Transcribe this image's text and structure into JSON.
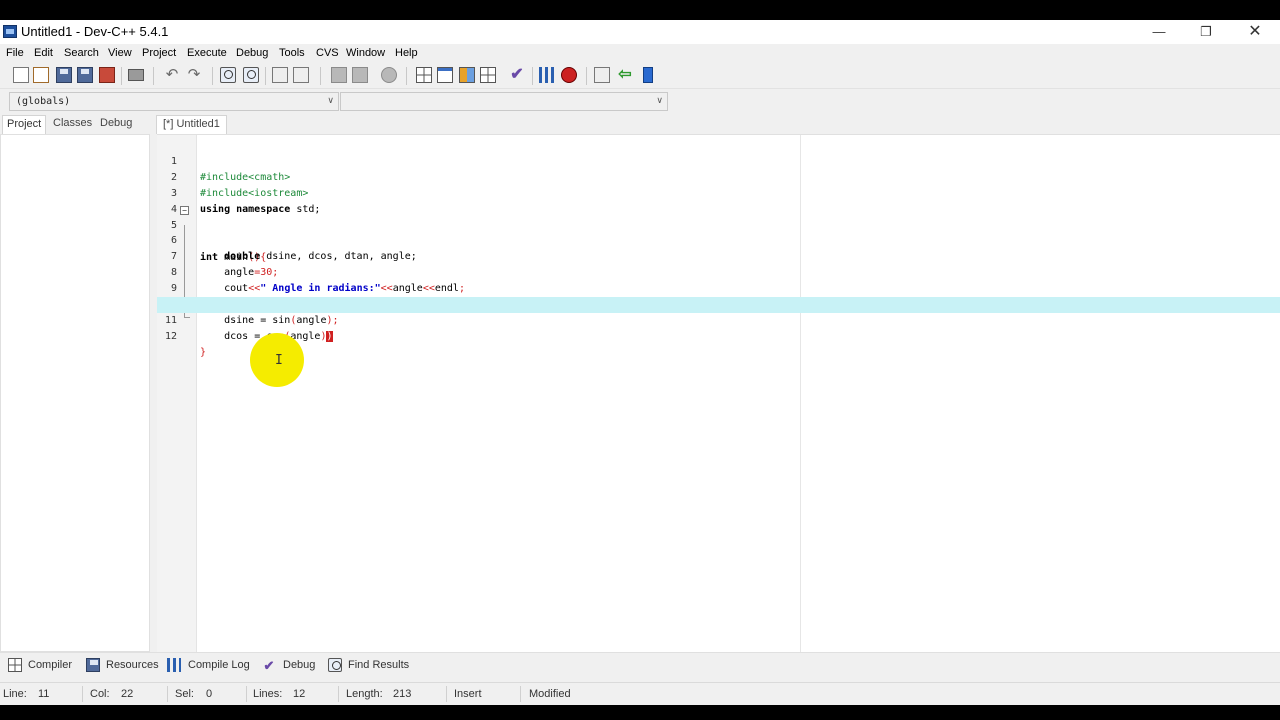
{
  "window": {
    "title": "Untitled1 - Dev-C++ 5.4.1",
    "controls": {
      "minimize": "—",
      "maximize": "❐",
      "close": "✕"
    }
  },
  "menu": [
    "File",
    "Edit",
    "Search",
    "View",
    "Project",
    "Execute",
    "Debug",
    "Tools",
    "CVS",
    "Window",
    "Help"
  ],
  "toolbar": {
    "icons": [
      "new-file",
      "open",
      "save",
      "save-all",
      "close-file",
      "print",
      "undo",
      "redo",
      "find",
      "replace",
      "indent",
      "unindent",
      "back",
      "forward",
      "goto",
      "compile",
      "run",
      "compile-run",
      "rebuild",
      "syntax-check",
      "profile",
      "debug",
      "new-project",
      "import",
      "insert-class"
    ]
  },
  "combos": {
    "class": "(globals)",
    "member": ""
  },
  "left_tabs": [
    "Project",
    "Classes",
    "Debug"
  ],
  "editor_tab": "[*] Untitled1",
  "code": {
    "lines": [
      {
        "n": "1"
      },
      {
        "n": "2"
      },
      {
        "n": "3"
      },
      {
        "n": "4"
      },
      {
        "n": "5"
      },
      {
        "n": "6"
      },
      {
        "n": "7"
      },
      {
        "n": "8"
      },
      {
        "n": "9"
      },
      {
        "n": "10"
      },
      {
        "n": "11"
      },
      {
        "n": "12"
      }
    ],
    "tokens": {
      "l1": "#include<cmath>",
      "l2": "#include<iostream>",
      "l3_kw": "using namespace",
      "l3_rest": " std;",
      "l5_kw": "int",
      "l5_rest": " main",
      "l5_sym": "(){",
      "l6_kw": "double",
      "l6_rest": " dsine, dcos, dtan, angle;",
      "l7_a": "angle",
      "l7_b": "=30;",
      "l8_a": "cout",
      "l8_b": "<<",
      "l8_str": "\" Angle in radians:\"",
      "l8_c": "<<",
      "l8_d": "angle",
      "l8_e": "<<",
      "l8_f": "endl",
      "l8_g": ";",
      "l10_a": "dsine = sin",
      "l10_b": "(",
      "l10_c": "angle",
      "l10_d": ");",
      "l11_a": "dcos = cos",
      "l11_b": "(",
      "l11_c": "angle",
      "l11_d": ")",
      "l11_cursor": ")",
      "l12": "}"
    }
  },
  "bottom_tabs": [
    "Compiler",
    "Resources",
    "Compile Log",
    "Debug",
    "Find Results"
  ],
  "status": {
    "line_label": "Line:",
    "line": "11",
    "col_label": "Col:",
    "col": "22",
    "sel_label": "Sel:",
    "sel": "0",
    "lines_label": "Lines:",
    "lines": "12",
    "length_label": "Length:",
    "length": "213",
    "mode": "Insert",
    "state": "Modified"
  }
}
